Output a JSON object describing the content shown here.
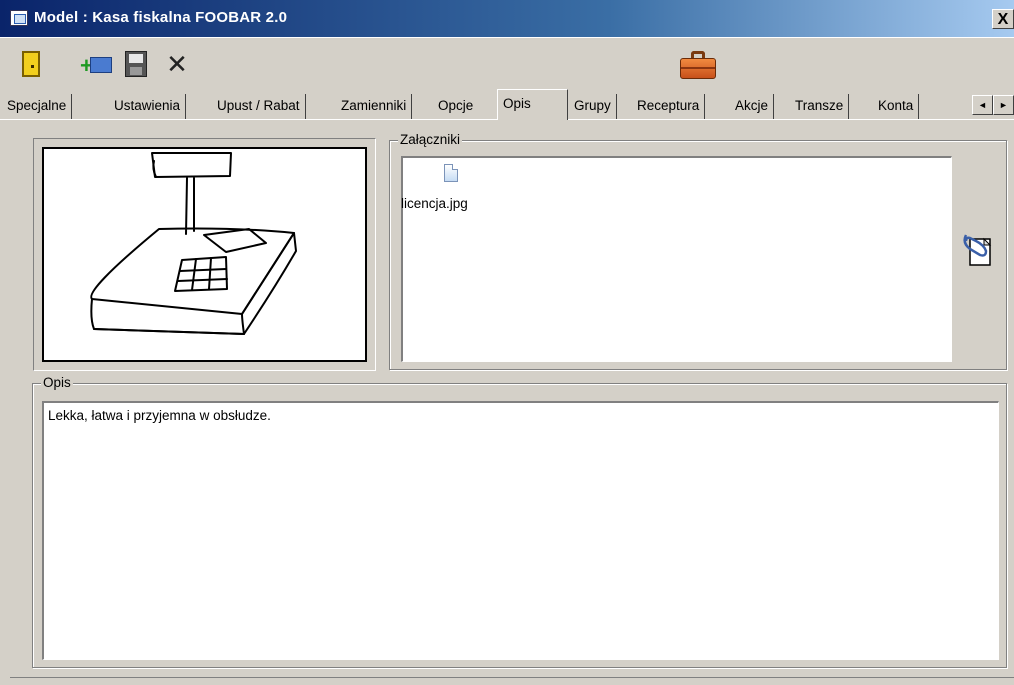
{
  "window": {
    "title": "Model : Kasa fiskalna FOOBAR 2.0",
    "close_label": "X"
  },
  "toolbar": {
    "icons": [
      "door-exit-icon",
      "add-box-icon",
      "save-disk-icon",
      "cut-scissors-icon",
      "briefcase-icon"
    ]
  },
  "tabs": [
    {
      "label": "Specjalne"
    },
    {
      "label": "Ustawienia"
    },
    {
      "label": "Upust / Rabat"
    },
    {
      "label": "Zamienniki"
    },
    {
      "label": "Opcje"
    },
    {
      "label": "Opis",
      "active": true
    },
    {
      "label": "Grupy"
    },
    {
      "label": "Receptura"
    },
    {
      "label": "Akcje"
    },
    {
      "label": "Transze"
    },
    {
      "label": "Konta"
    }
  ],
  "tab_scroll": {
    "left": "◄",
    "right": "►"
  },
  "attachments": {
    "label": "Załączniki",
    "files": [
      {
        "name": "licencja.jpg",
        "icon": "file-icon"
      }
    ]
  },
  "description": {
    "label": "Opis",
    "text": "Lekka, łatwa i przyjemna w obsłudze."
  },
  "colors": {
    "titlebar_start": "#0a246a",
    "titlebar_end": "#a6caf0",
    "window_bg": "#d4d0c8"
  }
}
